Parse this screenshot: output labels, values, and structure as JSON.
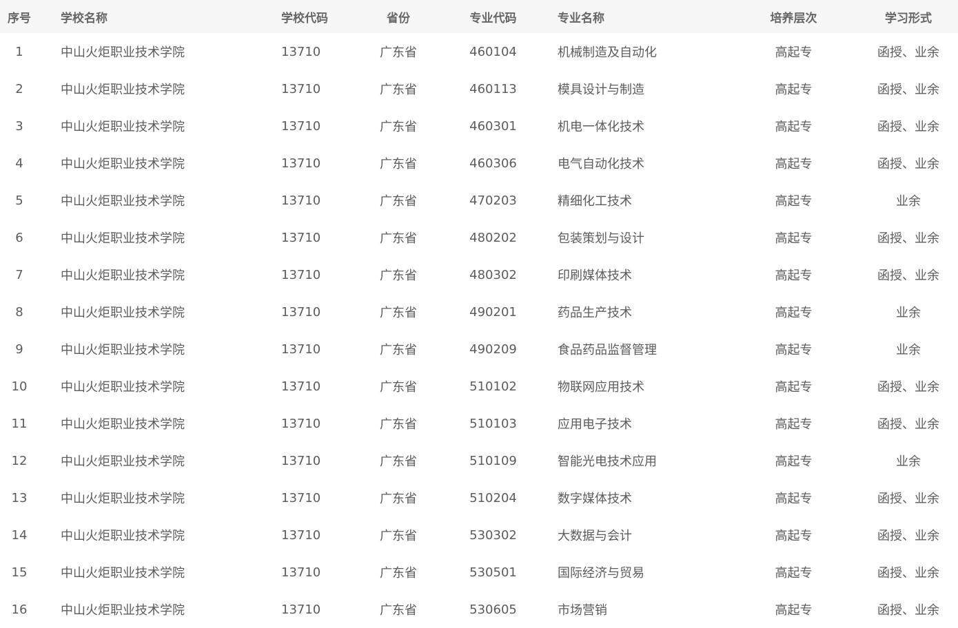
{
  "table": {
    "headers": [
      "序号",
      "学校名称",
      "学校代码",
      "省份",
      "专业代码",
      "专业名称",
      "培养层次",
      "学习形式"
    ],
    "rows": [
      [
        "1",
        "中山火炬职业技术学院",
        "13710",
        "广东省",
        "460104",
        "机械制造及自动化",
        "高起专",
        "函授、业余"
      ],
      [
        "2",
        "中山火炬职业技术学院",
        "13710",
        "广东省",
        "460113",
        "模具设计与制造",
        "高起专",
        "函授、业余"
      ],
      [
        "3",
        "中山火炬职业技术学院",
        "13710",
        "广东省",
        "460301",
        "机电一体化技术",
        "高起专",
        "函授、业余"
      ],
      [
        "4",
        "中山火炬职业技术学院",
        "13710",
        "广东省",
        "460306",
        "电气自动化技术",
        "高起专",
        "函授、业余"
      ],
      [
        "5",
        "中山火炬职业技术学院",
        "13710",
        "广东省",
        "470203",
        "精细化工技术",
        "高起专",
        "业余"
      ],
      [
        "6",
        "中山火炬职业技术学院",
        "13710",
        "广东省",
        "480202",
        "包装策划与设计",
        "高起专",
        "函授、业余"
      ],
      [
        "7",
        "中山火炬职业技术学院",
        "13710",
        "广东省",
        "480302",
        "印刷媒体技术",
        "高起专",
        "函授、业余"
      ],
      [
        "8",
        "中山火炬职业技术学院",
        "13710",
        "广东省",
        "490201",
        "药品生产技术",
        "高起专",
        "业余"
      ],
      [
        "9",
        "中山火炬职业技术学院",
        "13710",
        "广东省",
        "490209",
        "食品药品监督管理",
        "高起专",
        "业余"
      ],
      [
        "10",
        "中山火炬职业技术学院",
        "13710",
        "广东省",
        "510102",
        "物联网应用技术",
        "高起专",
        "函授、业余"
      ],
      [
        "11",
        "中山火炬职业技术学院",
        "13710",
        "广东省",
        "510103",
        "应用电子技术",
        "高起专",
        "函授、业余"
      ],
      [
        "12",
        "中山火炬职业技术学院",
        "13710",
        "广东省",
        "510109",
        "智能光电技术应用",
        "高起专",
        "业余"
      ],
      [
        "13",
        "中山火炬职业技术学院",
        "13710",
        "广东省",
        "510204",
        "数字媒体技术",
        "高起专",
        "函授、业余"
      ],
      [
        "14",
        "中山火炬职业技术学院",
        "13710",
        "广东省",
        "530302",
        "大数据与会计",
        "高起专",
        "函授、业余"
      ],
      [
        "15",
        "中山火炬职业技术学院",
        "13710",
        "广东省",
        "530501",
        "国际经济与贸易",
        "高起专",
        "函授、业余"
      ],
      [
        "16",
        "中山火炬职业技术学院",
        "13710",
        "广东省",
        "530605",
        "市场营销",
        "高起专",
        "函授、业余"
      ]
    ]
  },
  "colors": {
    "header_bg": "#f7f7f7",
    "header_text": "#666666",
    "cell_text": "#5c5c5c"
  }
}
